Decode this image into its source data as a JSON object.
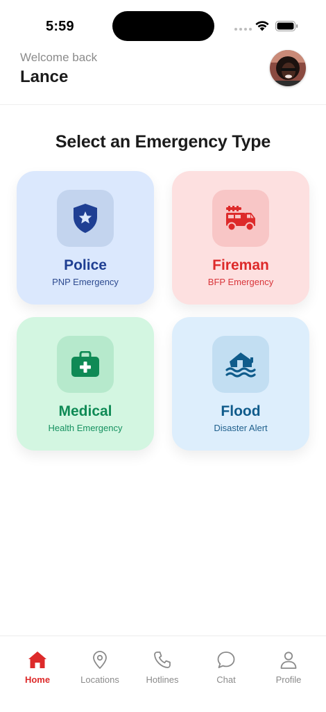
{
  "status_bar": {
    "time": "5:59"
  },
  "header": {
    "welcome": "Welcome back",
    "user_name": "Lance"
  },
  "main": {
    "title": "Select an Emergency Type",
    "cards": [
      {
        "title": "Police",
        "subtitle": "PNP Emergency",
        "icon": "shield-star-icon"
      },
      {
        "title": "Fireman",
        "subtitle": "BFP Emergency",
        "icon": "fire-truck-icon"
      },
      {
        "title": "Medical",
        "subtitle": "Health Emergency",
        "icon": "medical-kit-icon"
      },
      {
        "title": "Flood",
        "subtitle": "Disaster Alert",
        "icon": "flood-house-icon"
      }
    ]
  },
  "tabs": [
    {
      "label": "Home",
      "icon": "home-icon",
      "active": true
    },
    {
      "label": "Locations",
      "icon": "location-pin-icon",
      "active": false
    },
    {
      "label": "Hotlines",
      "icon": "phone-icon",
      "active": false
    },
    {
      "label": "Chat",
      "icon": "chat-bubble-icon",
      "active": false
    },
    {
      "label": "Profile",
      "icon": "person-icon",
      "active": false
    }
  ],
  "colors": {
    "accent": "#dd2a2a",
    "police": "#1f3f93",
    "fire": "#dd2a2a",
    "medical": "#0f8a55",
    "flood": "#0f5b8b"
  }
}
